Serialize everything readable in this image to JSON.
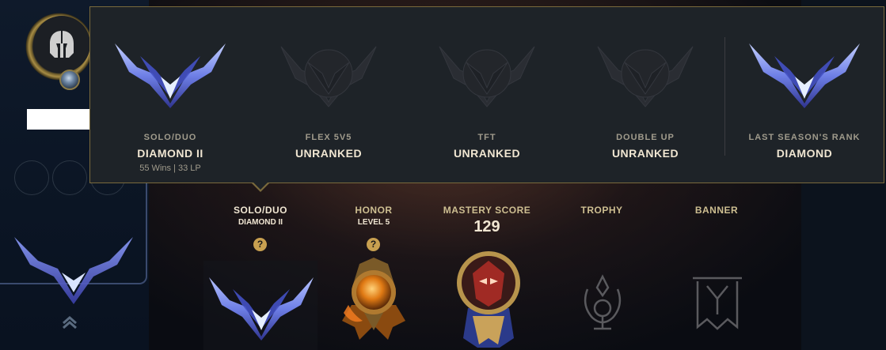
{
  "popup": {
    "ranks": [
      {
        "queue": "SOLO/DUO",
        "tier": "DIAMOND II",
        "detail": "55 Wins | 33 LP",
        "ranked": true
      },
      {
        "queue": "FLEX 5V5",
        "tier": "UNRANKED",
        "detail": "",
        "ranked": false
      },
      {
        "queue": "TFT",
        "tier": "UNRANKED",
        "detail": "",
        "ranked": false
      },
      {
        "queue": "DOUBLE UP",
        "tier": "UNRANKED",
        "detail": "",
        "ranked": false
      },
      {
        "queue": "LAST SEASON'S RANK",
        "tier": "DIAMOND",
        "detail": "",
        "ranked": true
      }
    ]
  },
  "stats": {
    "solo": {
      "label": "SOLO/DUO",
      "sub": "DIAMOND II",
      "help": "?"
    },
    "honor": {
      "label": "HONOR",
      "sub": "LEVEL 5",
      "help": "?"
    },
    "mastery": {
      "label": "MASTERY SCORE",
      "value": "129"
    },
    "trophy": {
      "label": "TROPHY"
    },
    "banner": {
      "label": "BANNER"
    }
  },
  "icons": {
    "avatar": "helmet-icon",
    "level": "level-orb-icon",
    "expand": "chevron-up-icon"
  },
  "colors": {
    "gold_border": "#7a6a3c",
    "text_primary": "#f0e6d2",
    "text_muted": "#a09b8c",
    "help_gold": "#c8a050",
    "diamond_blue": "#6e7fe6"
  }
}
